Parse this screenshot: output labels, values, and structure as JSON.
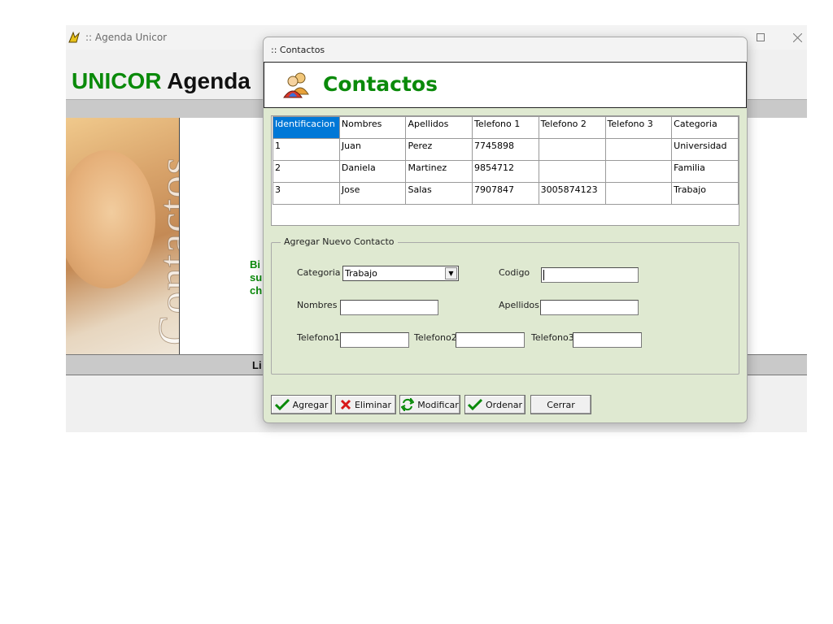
{
  "main_window": {
    "title": ":: Agenda Unicor",
    "brand_unicor": "UNICOR",
    "brand_agenda": "Agenda",
    "photo_text": "Contactos",
    "welcome_text": "Bi\nsu\nch",
    "bottom_band_text": "Li"
  },
  "dialog": {
    "title": ":: Contactos",
    "header_title": "Contactos",
    "grid": {
      "headers": [
        "Identificacion",
        "Nombres",
        "Apellidos",
        "Telefono 1",
        "Telefono 2",
        "Telefono 3",
        "Categoria"
      ],
      "rows": [
        [
          "1",
          "Juan",
          "Perez",
          "7745898",
          "",
          "",
          "Universidad"
        ],
        [
          "2",
          "Daniela",
          "Martinez",
          "9854712",
          "",
          "",
          "Familia"
        ],
        [
          "3",
          "Jose",
          "Salas",
          "7907847",
          "3005874123",
          "",
          "Trabajo"
        ]
      ]
    },
    "form": {
      "legend": "Agregar Nuevo Contacto",
      "categoria_label": "Categoria",
      "categoria_value": "Trabajo",
      "codigo_label": "Codigo",
      "nombres_label": "Nombres",
      "apellidos_label": "Apellidos",
      "telefono1_label": "Telefono1",
      "telefono2_label": "Telefono2",
      "telefono3_label": "Telefono3"
    },
    "buttons": {
      "agregar": "Agregar",
      "eliminar": "Eliminar",
      "modificar": "Modificar",
      "ordenar": "Ordenar",
      "cerrar": "Cerrar"
    }
  },
  "colors": {
    "brand_green": "#0a8a0a",
    "dialog_bg": "#dfe9d1",
    "selection_blue": "#0078d7"
  }
}
